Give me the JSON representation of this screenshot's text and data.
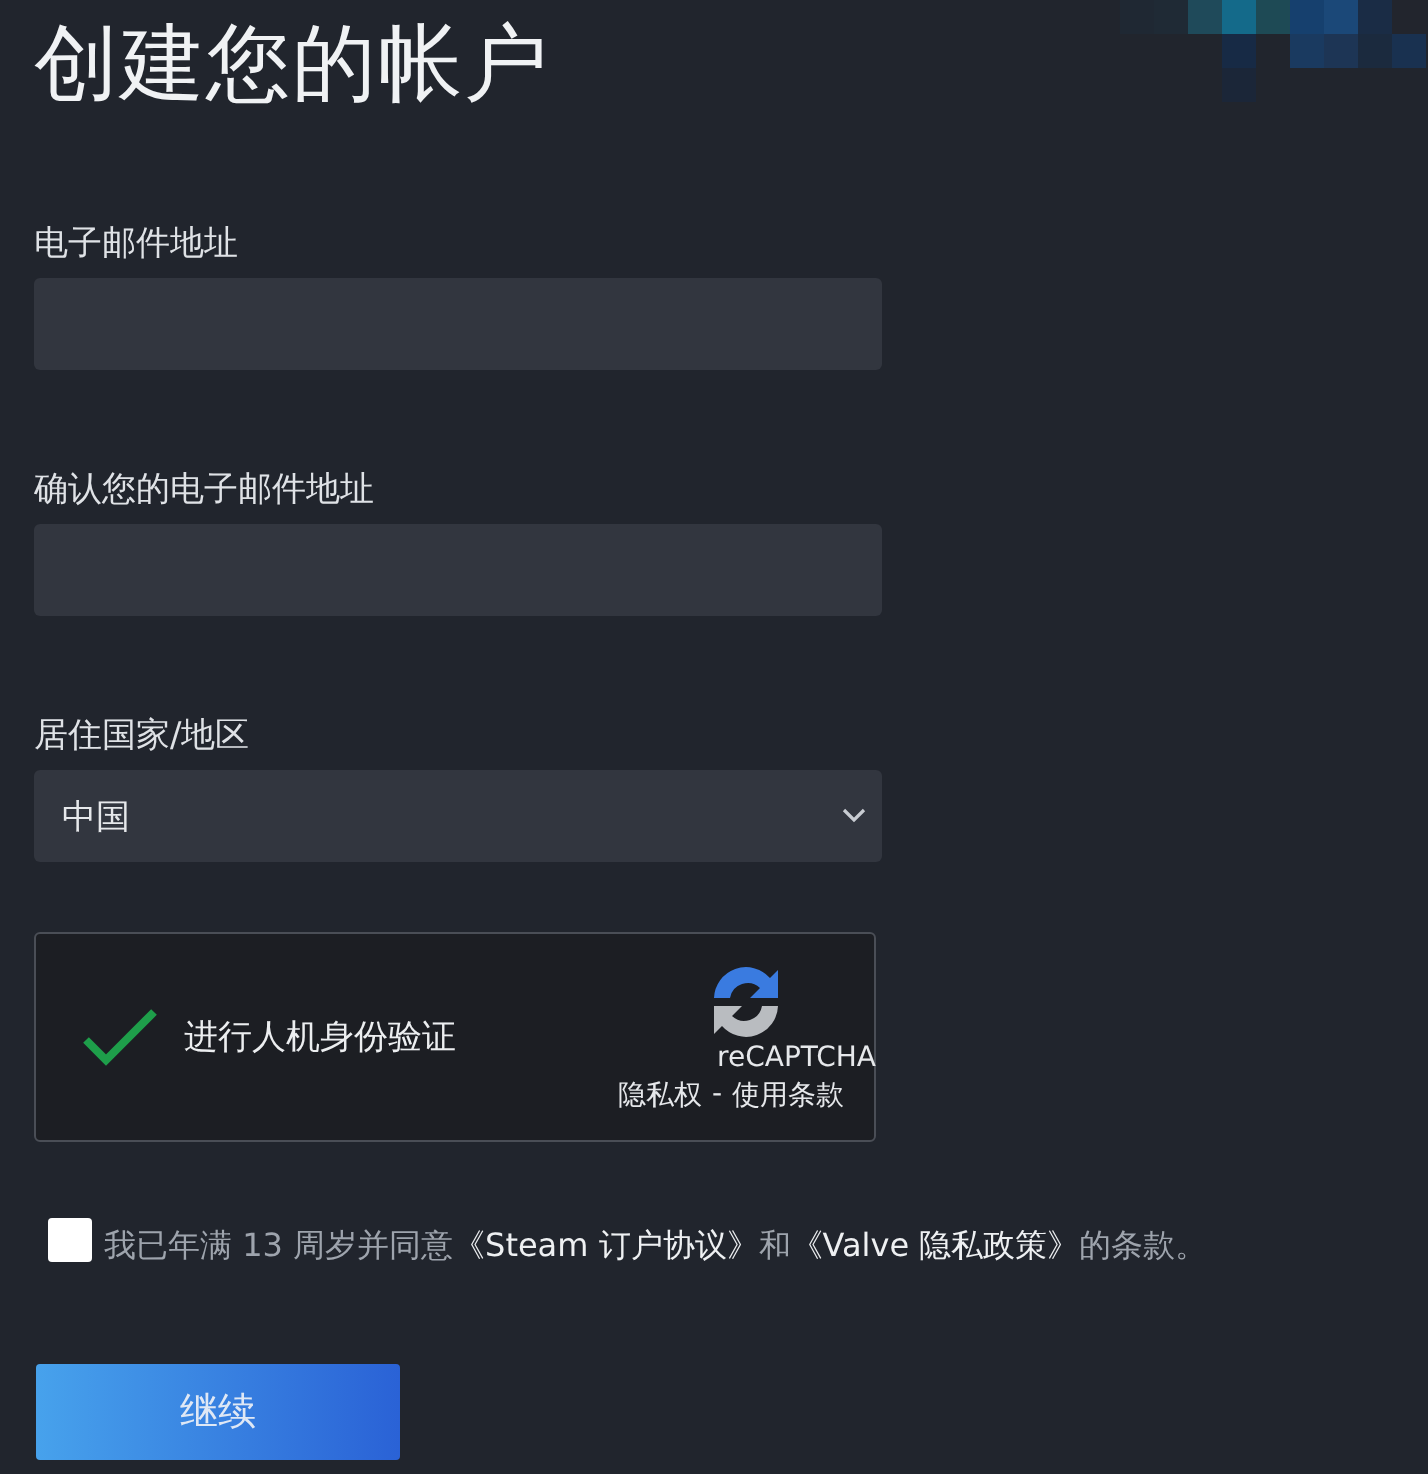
{
  "title": "创建您的帐户",
  "fields": [
    {
      "label": "电子邮件地址",
      "kind": "text"
    },
    {
      "label": "确认您的电子邮件地址",
      "kind": "text"
    },
    {
      "label": "居住国家/地区",
      "kind": "select",
      "value": "中国"
    }
  ],
  "captcha": {
    "checked": true,
    "label": "进行人机身份验证",
    "brand": "reCAPTCHA",
    "privacy": "隐私权",
    "separator": "-",
    "terms": "使用条款"
  },
  "agreement": {
    "checked": false,
    "before": "我已年满 13 周岁并同意",
    "link1": "《Steam 订户协议》",
    "middle": "和",
    "link2": "《Valve 隐私政策》",
    "after": "的条款。"
  },
  "continue_button": "继续"
}
